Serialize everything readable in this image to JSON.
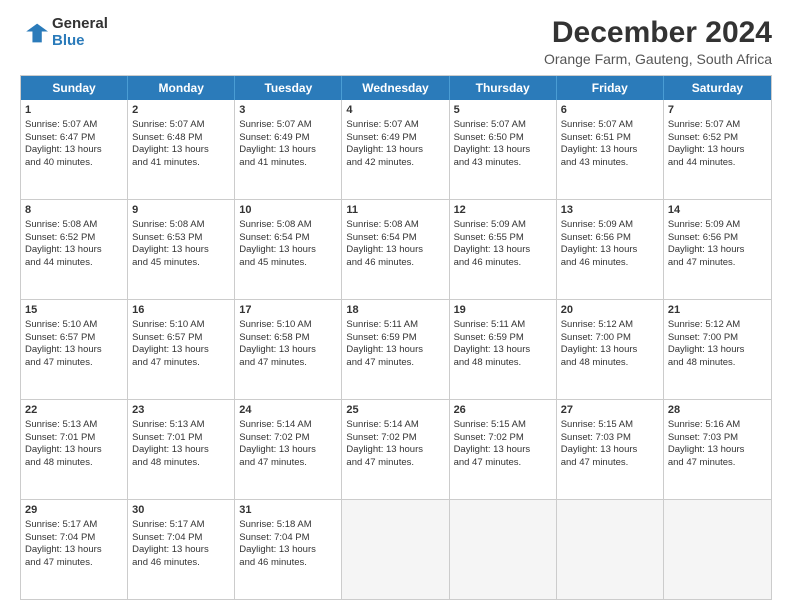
{
  "logo": {
    "general": "General",
    "blue": "Blue"
  },
  "title": "December 2024",
  "subtitle": "Orange Farm, Gauteng, South Africa",
  "header_days": [
    "Sunday",
    "Monday",
    "Tuesday",
    "Wednesday",
    "Thursday",
    "Friday",
    "Saturday"
  ],
  "weeks": [
    [
      {
        "day": "1",
        "rise": "5:07 AM",
        "set": "6:47 PM",
        "daylight": "13 hours and 40 minutes."
      },
      {
        "day": "2",
        "rise": "5:07 AM",
        "set": "6:48 PM",
        "daylight": "13 hours and 41 minutes."
      },
      {
        "day": "3",
        "rise": "5:07 AM",
        "set": "6:49 PM",
        "daylight": "13 hours and 41 minutes."
      },
      {
        "day": "4",
        "rise": "5:07 AM",
        "set": "6:49 PM",
        "daylight": "13 hours and 42 minutes."
      },
      {
        "day": "5",
        "rise": "5:07 AM",
        "set": "6:50 PM",
        "daylight": "13 hours and 43 minutes."
      },
      {
        "day": "6",
        "rise": "5:07 AM",
        "set": "6:51 PM",
        "daylight": "13 hours and 43 minutes."
      },
      {
        "day": "7",
        "rise": "5:07 AM",
        "set": "6:52 PM",
        "daylight": "13 hours and 44 minutes."
      }
    ],
    [
      {
        "day": "8",
        "rise": "5:08 AM",
        "set": "6:52 PM",
        "daylight": "13 hours and 44 minutes."
      },
      {
        "day": "9",
        "rise": "5:08 AM",
        "set": "6:53 PM",
        "daylight": "13 hours and 45 minutes."
      },
      {
        "day": "10",
        "rise": "5:08 AM",
        "set": "6:54 PM",
        "daylight": "13 hours and 45 minutes."
      },
      {
        "day": "11",
        "rise": "5:08 AM",
        "set": "6:54 PM",
        "daylight": "13 hours and 46 minutes."
      },
      {
        "day": "12",
        "rise": "5:09 AM",
        "set": "6:55 PM",
        "daylight": "13 hours and 46 minutes."
      },
      {
        "day": "13",
        "rise": "5:09 AM",
        "set": "6:56 PM",
        "daylight": "13 hours and 46 minutes."
      },
      {
        "day": "14",
        "rise": "5:09 AM",
        "set": "6:56 PM",
        "daylight": "13 hours and 47 minutes."
      }
    ],
    [
      {
        "day": "15",
        "rise": "5:10 AM",
        "set": "6:57 PM",
        "daylight": "13 hours and 47 minutes."
      },
      {
        "day": "16",
        "rise": "5:10 AM",
        "set": "6:57 PM",
        "daylight": "13 hours and 47 minutes."
      },
      {
        "day": "17",
        "rise": "5:10 AM",
        "set": "6:58 PM",
        "daylight": "13 hours and 47 minutes."
      },
      {
        "day": "18",
        "rise": "5:11 AM",
        "set": "6:59 PM",
        "daylight": "13 hours and 47 minutes."
      },
      {
        "day": "19",
        "rise": "5:11 AM",
        "set": "6:59 PM",
        "daylight": "13 hours and 48 minutes."
      },
      {
        "day": "20",
        "rise": "5:12 AM",
        "set": "7:00 PM",
        "daylight": "13 hours and 48 minutes."
      },
      {
        "day": "21",
        "rise": "5:12 AM",
        "set": "7:00 PM",
        "daylight": "13 hours and 48 minutes."
      }
    ],
    [
      {
        "day": "22",
        "rise": "5:13 AM",
        "set": "7:01 PM",
        "daylight": "13 hours and 48 minutes."
      },
      {
        "day": "23",
        "rise": "5:13 AM",
        "set": "7:01 PM",
        "daylight": "13 hours and 48 minutes."
      },
      {
        "day": "24",
        "rise": "5:14 AM",
        "set": "7:02 PM",
        "daylight": "13 hours and 47 minutes."
      },
      {
        "day": "25",
        "rise": "5:14 AM",
        "set": "7:02 PM",
        "daylight": "13 hours and 47 minutes."
      },
      {
        "day": "26",
        "rise": "5:15 AM",
        "set": "7:02 PM",
        "daylight": "13 hours and 47 minutes."
      },
      {
        "day": "27",
        "rise": "5:15 AM",
        "set": "7:03 PM",
        "daylight": "13 hours and 47 minutes."
      },
      {
        "day": "28",
        "rise": "5:16 AM",
        "set": "7:03 PM",
        "daylight": "13 hours and 47 minutes."
      }
    ],
    [
      {
        "day": "29",
        "rise": "5:17 AM",
        "set": "7:04 PM",
        "daylight": "13 hours and 47 minutes."
      },
      {
        "day": "30",
        "rise": "5:17 AM",
        "set": "7:04 PM",
        "daylight": "13 hours and 46 minutes."
      },
      {
        "day": "31",
        "rise": "5:18 AM",
        "set": "7:04 PM",
        "daylight": "13 hours and 46 minutes."
      },
      null,
      null,
      null,
      null
    ]
  ]
}
